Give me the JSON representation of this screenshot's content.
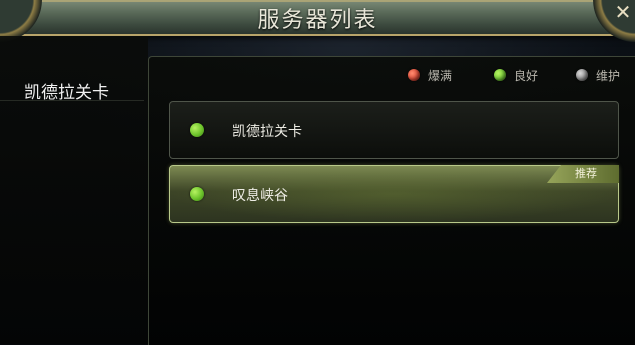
{
  "window": {
    "title": "服务器列表"
  },
  "sidebar": {
    "items": [
      {
        "label": "凯德拉关卡"
      }
    ]
  },
  "legend": [
    {
      "label": "爆满",
      "color": "#e0503c"
    },
    {
      "label": "良好",
      "color": "#7ad13a"
    },
    {
      "label": "维护",
      "color": "#9a9a9a"
    }
  ],
  "servers": [
    {
      "name": "凯德拉关卡",
      "status": "良好",
      "selected": false,
      "badge": ""
    },
    {
      "name": "叹息峡谷",
      "status": "良好",
      "selected": true,
      "badge": "推荐"
    }
  ],
  "colors": {
    "accent_gold": "#b8a46a",
    "status_good": "#7ad13a",
    "status_full": "#e0503c",
    "status_maintenance": "#9a9a9a",
    "selected_green": "#7d8a52"
  }
}
